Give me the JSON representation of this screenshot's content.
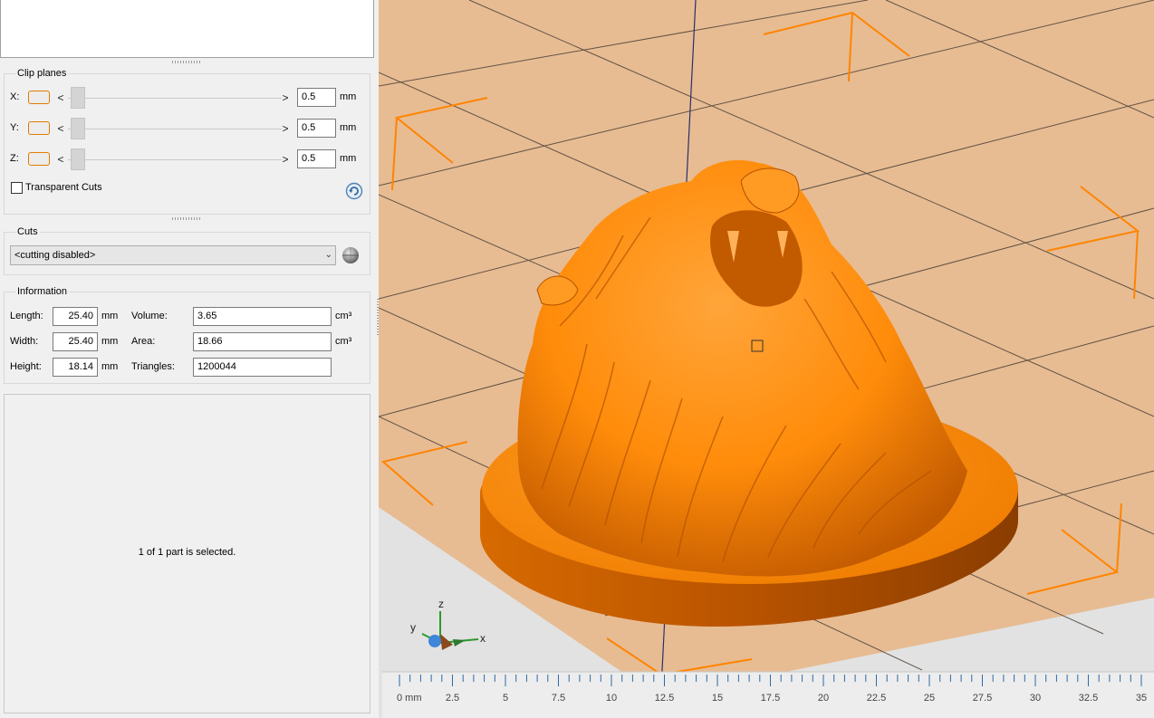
{
  "clip_planes": {
    "title": "Clip planes",
    "rows": [
      {
        "axis": "X:",
        "value": "0.5",
        "unit": "mm"
      },
      {
        "axis": "Y:",
        "value": "0.5",
        "unit": "mm"
      },
      {
        "axis": "Z:",
        "value": "0.5",
        "unit": "mm"
      }
    ],
    "prev_glyph": "<",
    "next_glyph": ">",
    "transparent_cuts_label": "Transparent Cuts",
    "transparent_cuts_checked": false
  },
  "cuts": {
    "title": "Cuts",
    "selected": "<cutting disabled>"
  },
  "information": {
    "title": "Information",
    "length_label": "Length:",
    "length_value": "25.40",
    "length_unit": "mm",
    "width_label": "Width:",
    "width_value": "25.40",
    "width_unit": "mm",
    "height_label": "Height:",
    "height_value": "18.14",
    "height_unit": "mm",
    "volume_label": "Volume:",
    "volume_value": "3.65",
    "volume_unit": "cm³",
    "area_label": "Area:",
    "area_value": "18.66",
    "area_unit": "cm³",
    "triangles_label": "Triangles:",
    "triangles_value": "1200044"
  },
  "selection_status": "1 of 1 part is selected.",
  "axis_gizmo": {
    "x": "x",
    "y": "y",
    "z": "z"
  },
  "ruler": {
    "labels": [
      "0 mm",
      "2.5",
      "5",
      "7.5",
      "10",
      "12.5",
      "15",
      "17.5",
      "20",
      "22.5",
      "25",
      "27.5",
      "30",
      "32.5",
      "35"
    ]
  },
  "colors": {
    "model": "#ff8c0a",
    "model_shadow": "#c25a00",
    "bed": "#e7bc93",
    "marker": "#ff8400",
    "accent_border": "#e07b00"
  }
}
